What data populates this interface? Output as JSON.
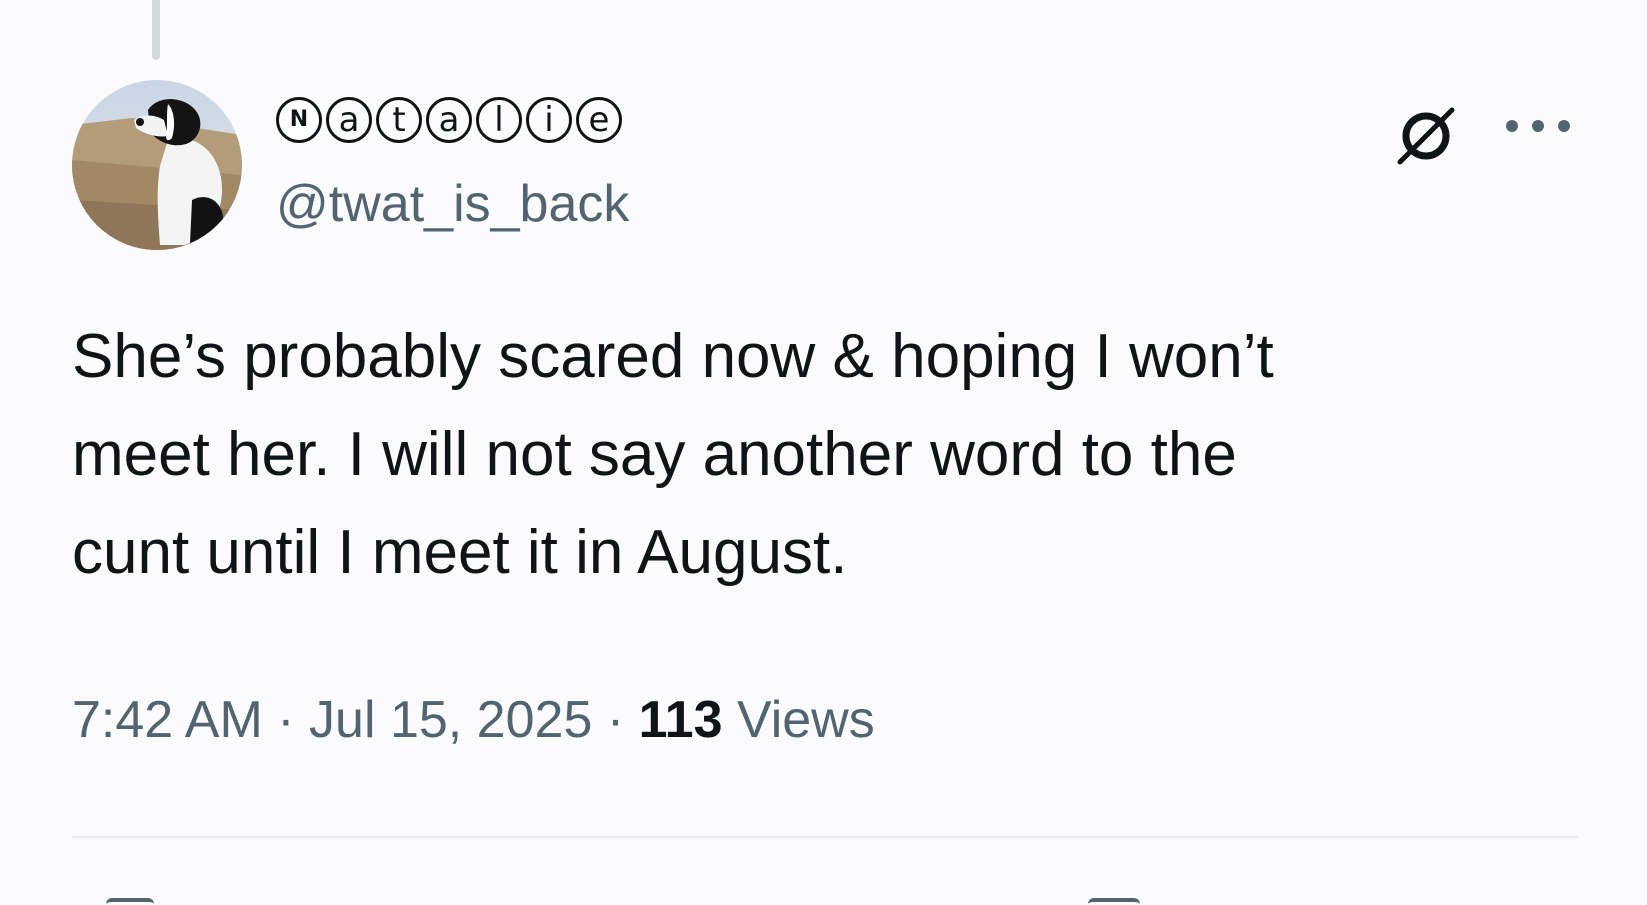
{
  "tweet": {
    "author": {
      "display_name_letters": [
        "N",
        "a",
        "t",
        "a",
        "l",
        "i",
        "e"
      ],
      "handle": "@twat_is_back"
    },
    "text_lines": [
      "She’s probably scared now & hoping I won’t",
      "meet her. I will not say another word to the",
      "cunt until I meet it in August."
    ],
    "meta": {
      "time": "7:42 AM",
      "separator": "·",
      "date": "Jul 15, 2025",
      "views_count": "113",
      "views_label": "Views"
    },
    "icons": {
      "badge": "empty-set-icon",
      "more": "more-options-icon"
    }
  },
  "colors": {
    "text_primary": "#0f1419",
    "text_secondary": "#536471",
    "divider": "#e6ecf0",
    "background": "#fbfbfd"
  }
}
